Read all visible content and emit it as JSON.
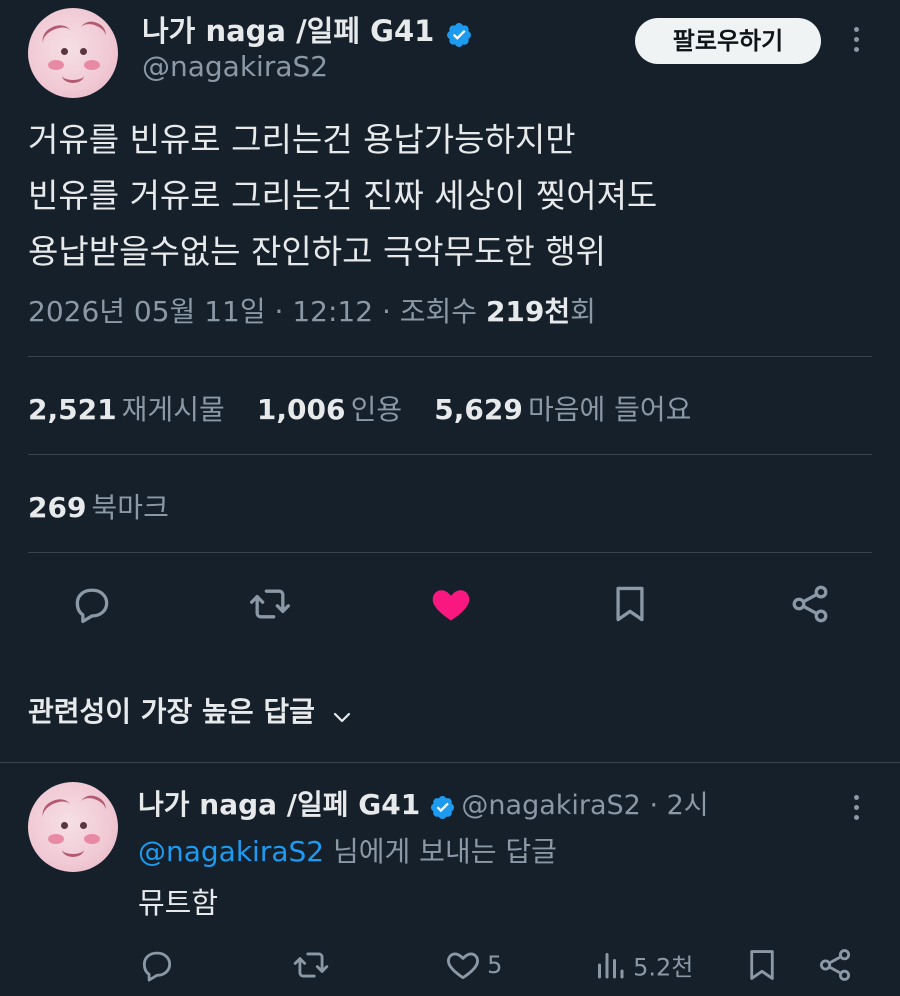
{
  "tweet": {
    "author": {
      "display_name": "나가 naga /일페 G41",
      "handle": "@nagakiraS2",
      "verified": true
    },
    "follow_label": "팔로우하기",
    "lines": [
      "거유를 빈유로 그리는건 용납가능하지만",
      "빈유를 거유로 그리는건 진짜 세상이 찢어져도",
      "용납받을수없는 잔인하고 극악무도한 행위"
    ],
    "meta": {
      "date": "2026년 05월 11일",
      "time": "12:12",
      "views_label": "조회수",
      "views_num": "219천",
      "views_unit": "회"
    },
    "stats": {
      "retweets_num": "2,521",
      "retweets_label": "재게시물",
      "quotes_num": "1,006",
      "quotes_label": "인용",
      "likes_num": "5,629",
      "likes_label": "마음에 들어요",
      "bookmarks_num": "269",
      "bookmarks_label": "북마크"
    },
    "actions": [
      "reply-icon",
      "retweet-icon",
      "heart-filled-icon",
      "bookmark-icon",
      "share-icon"
    ]
  },
  "replies_header": {
    "label": "관련성이 가장 높은 답글"
  },
  "reply": {
    "display_name": "나가 naga /일페 G41",
    "handle": "@nagakiraS2",
    "time": "2시",
    "reply_to_handle": "@nagakiraS2",
    "reply_to_suffix": "님에게 보내는 답글",
    "text": "뮤트함",
    "likes": "5",
    "views": "5.2천"
  },
  "colors": {
    "background": "#15202b",
    "text": "#e7e9ea",
    "muted": "#8b98a5",
    "accent_blue": "#1d9bf0",
    "like_pink": "#f91880",
    "divider": "#38444d"
  }
}
